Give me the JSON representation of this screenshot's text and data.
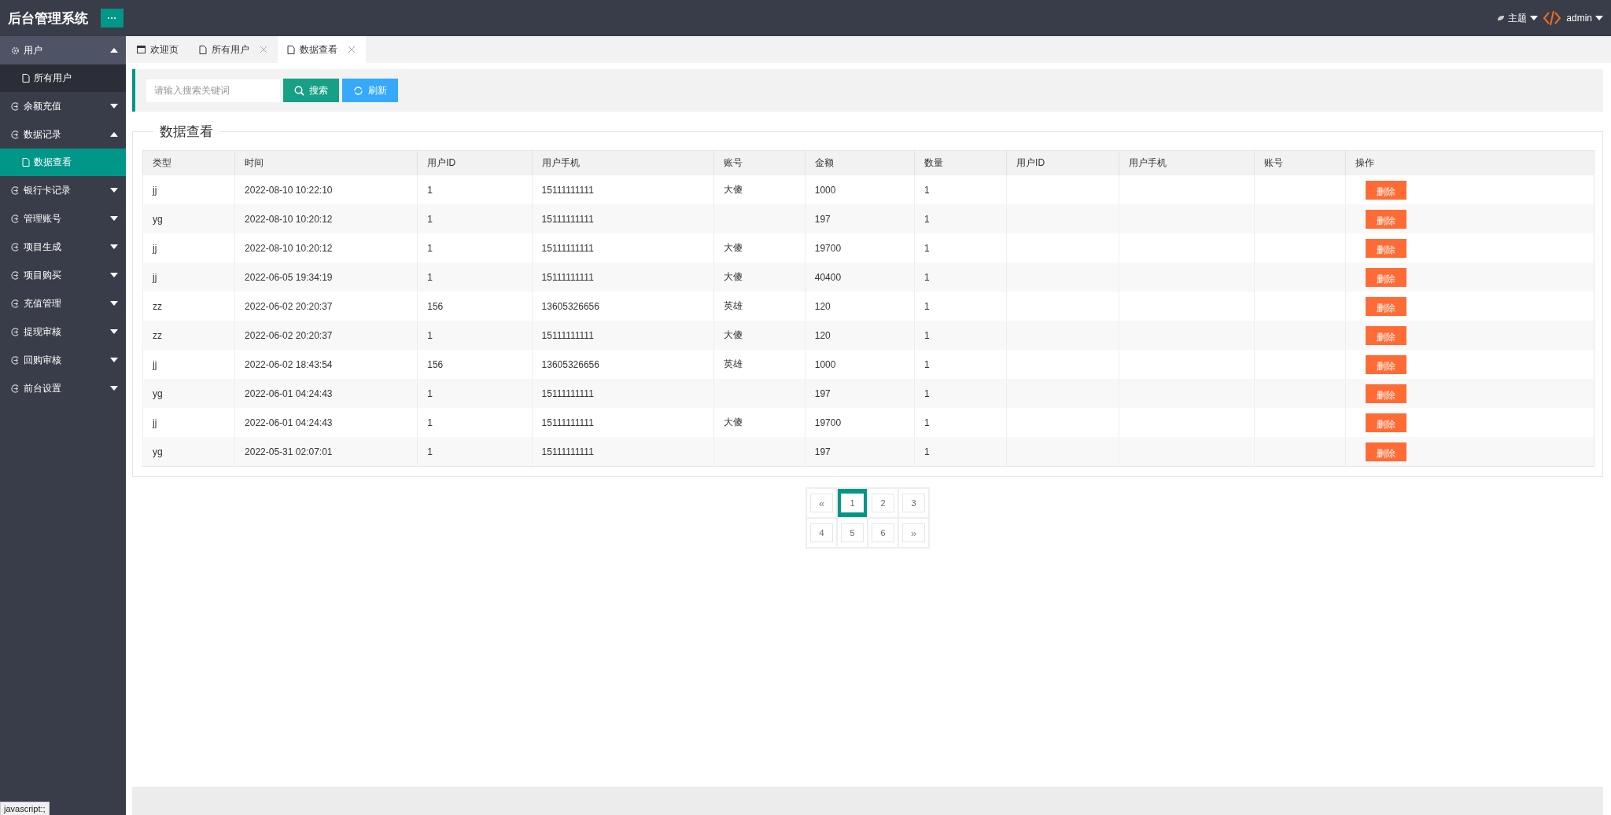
{
  "header": {
    "title": "后台管理系统",
    "menu_button": "···",
    "theme": "主题",
    "user": "admin"
  },
  "sidebar": {
    "items": [
      {
        "label": "用户",
        "kind": "settings",
        "expanded": true,
        "children": [
          {
            "label": "所有用户",
            "selected": false
          }
        ]
      },
      {
        "label": "余额充值",
        "kind": "module",
        "expanded": false
      },
      {
        "label": "数据记录",
        "kind": "module",
        "expanded": true,
        "children": [
          {
            "label": "数据查看",
            "selected": true
          }
        ]
      },
      {
        "label": "银行卡记录",
        "kind": "module",
        "expanded": false
      },
      {
        "label": "管理账号",
        "kind": "module",
        "expanded": false
      },
      {
        "label": "项目生成",
        "kind": "module",
        "expanded": false
      },
      {
        "label": "项目购买",
        "kind": "module",
        "expanded": false
      },
      {
        "label": "充值管理",
        "kind": "module",
        "expanded": false
      },
      {
        "label": "提现审核",
        "kind": "module",
        "expanded": false
      },
      {
        "label": "回购审核",
        "kind": "module",
        "expanded": false
      },
      {
        "label": "前台设置",
        "kind": "module",
        "expanded": false
      }
    ]
  },
  "tabs": [
    {
      "label": "欢迎页",
      "kind": "home",
      "closable": false,
      "selected": false
    },
    {
      "label": "所有用户",
      "kind": "page",
      "closable": true,
      "selected": false
    },
    {
      "label": "数据查看",
      "kind": "page",
      "closable": true,
      "selected": true
    }
  ],
  "toolbar": {
    "search": {
      "placeholder": "请输入搜索关键词"
    },
    "search_button": "搜索",
    "refresh_button": "刷新"
  },
  "panel": {
    "title": "数据查看"
  },
  "table": {
    "columns": [
      "类型",
      "时间",
      "用户ID",
      "用户手机",
      "账号",
      "金额",
      "数量",
      "用户ID",
      "用户手机",
      "账号",
      "操作"
    ],
    "rows": [
      {
        "cells": [
          "jj",
          "2022-08-10 10:22:10",
          "1",
          "15111111111",
          "大傻",
          "1000",
          "1"
        ],
        "action": "删除"
      },
      {
        "cells": [
          "yg",
          "2022-08-10 10:20:12",
          "1",
          "15111111111",
          "",
          "197",
          "1"
        ],
        "action": "删除"
      },
      {
        "cells": [
          "jj",
          "2022-08-10 10:20:12",
          "1",
          "15111111111",
          "大傻",
          "19700",
          "1"
        ],
        "action": "删除"
      },
      {
        "cells": [
          "jj",
          "2022-06-05 19:34:19",
          "1",
          "15111111111",
          "大傻",
          "40400",
          "1"
        ],
        "action": "删除"
      },
      {
        "cells": [
          "zz",
          "2022-06-02 20:20:37",
          "156",
          "13605326656",
          "英雄",
          "120",
          "1"
        ],
        "action": "删除"
      },
      {
        "cells": [
          "zz",
          "2022-06-02 20:20:37",
          "1",
          "15111111111",
          "大傻",
          "120",
          "1"
        ],
        "action": "删除"
      },
      {
        "cells": [
          "jj",
          "2022-06-02 18:43:54",
          "156",
          "13605326656",
          "英雄",
          "1000",
          "1"
        ],
        "action": "删除"
      },
      {
        "cells": [
          "yg",
          "2022-06-01 04:24:43",
          "1",
          "15111111111",
          "",
          "197",
          "1"
        ],
        "action": "删除"
      },
      {
        "cells": [
          "jj",
          "2022-06-01 04:24:43",
          "1",
          "15111111111",
          "大傻",
          "19700",
          "1"
        ],
        "action": "删除"
      },
      {
        "cells": [
          "yg",
          "2022-05-31 02:07:01",
          "1",
          "15111111111",
          "",
          "197",
          "1"
        ],
        "action": "删除"
      }
    ]
  },
  "pagination": [
    {
      "label": "«",
      "kind": "nav",
      "selected": false
    },
    {
      "label": "1",
      "kind": "page",
      "selected": true
    },
    {
      "label": "2",
      "kind": "page",
      "selected": false
    },
    {
      "label": "3",
      "kind": "page",
      "selected": false
    },
    {
      "label": "4",
      "kind": "page",
      "selected": false
    },
    {
      "label": "5",
      "kind": "page",
      "selected": false
    },
    {
      "label": "6",
      "kind": "page",
      "selected": false
    },
    {
      "label": "»",
      "kind": "nav",
      "selected": false
    }
  ],
  "status_bar": {
    "link": "javascript:;"
  }
}
